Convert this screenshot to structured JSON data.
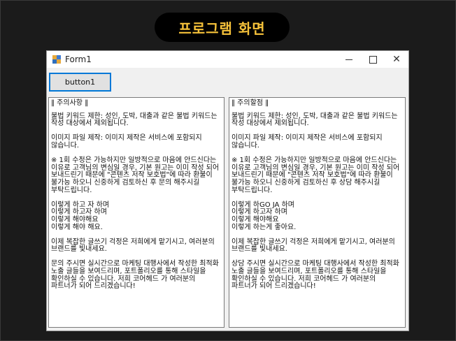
{
  "banner": {
    "title": "프로그램 화면"
  },
  "window": {
    "title": "Form1",
    "controls": {
      "minimize": "–",
      "maximize": "□",
      "close": "✕"
    },
    "button_label": "button1",
    "left_textbox": [
      "‖ 주의사항 ‖",
      "불법 키워드 제한: 성인, 도박, 대출과 같은 불법 키워드는 작성 대상에서 제외됩니다.",
      "이미지 파일 제작: 이미지 제작은 서비스에 포함되지 않습니다.",
      "※ 1회 수정은 가능하지만 일방적으로 마음에 안드신다는 이유로 고객님의 변심일 경우, 기본 원고는 이미 작성 되어 보내드린기 때문에 \"콘텐츠 저작 보호법\"에 따라 환불이 불가능 하오니 신중하게 검토하신 후 문의 해주시길 부탁드립니다.",
      "이렇게 하고 자 하며\n이렇게 하고자 하며\n이렇게 해야해요\n이렇게 해야 해요.",
      "이제 복잡한 글쓰기 걱정은 저희에게 맡기시고, 여러분의 브랜드를 빛내세요.",
      "문의 주시면 실시간으로 마케팅 대행사에서 작성한 최적화 노출 글들을 보여드리며, 포트폴리오를 통해 스타일을 확인하실 수 있습니다. 저희 코어헤드 가 여러분의 파트너가 되어 드리겠습니다!"
    ],
    "right_textbox": [
      "‖ 주의할점 ‖",
      "불법 키워드 제한: 성인, 도박, 대출과 같은 불법 키워드는 작성 대상에서 제외됩니다.",
      "이미지 파일 제작: 이미지 제작은 서비스에 포함되지 않습니다.",
      "※ 1회 수정은 가능하지만 일방적으로 마음에 안드신다는 이유로 고객님의 변심일 경우, 기본 원고는 이미 작성 되어 보내드린기 때문에 \"콘텐츠 저작 보호법\"에 따라 환불이 불가능 하오니 신중하게 검토하신 후 상담 해주시길 부탁드립니다.",
      "이렇게 하GO JA 하며\n이렇게 하고자 하며\n이렇게 해야해요\n이렇게 하는게 좋아요.",
      "이제 복잡한 글쓰기 걱정은 저희에게 맡기시고, 여러분의 브랜드를 빛내세요.",
      "상담 주시면 실시간으로 마케팅 대행사에서 작성한 최적화 노출 글들을 보여드리며, 포트폴리오를 통해 스타일을 확인하실 수 있습니다. 저희 코어헤드 가 여러분의 파트너가 되어 드리겠습니다!"
    ]
  }
}
